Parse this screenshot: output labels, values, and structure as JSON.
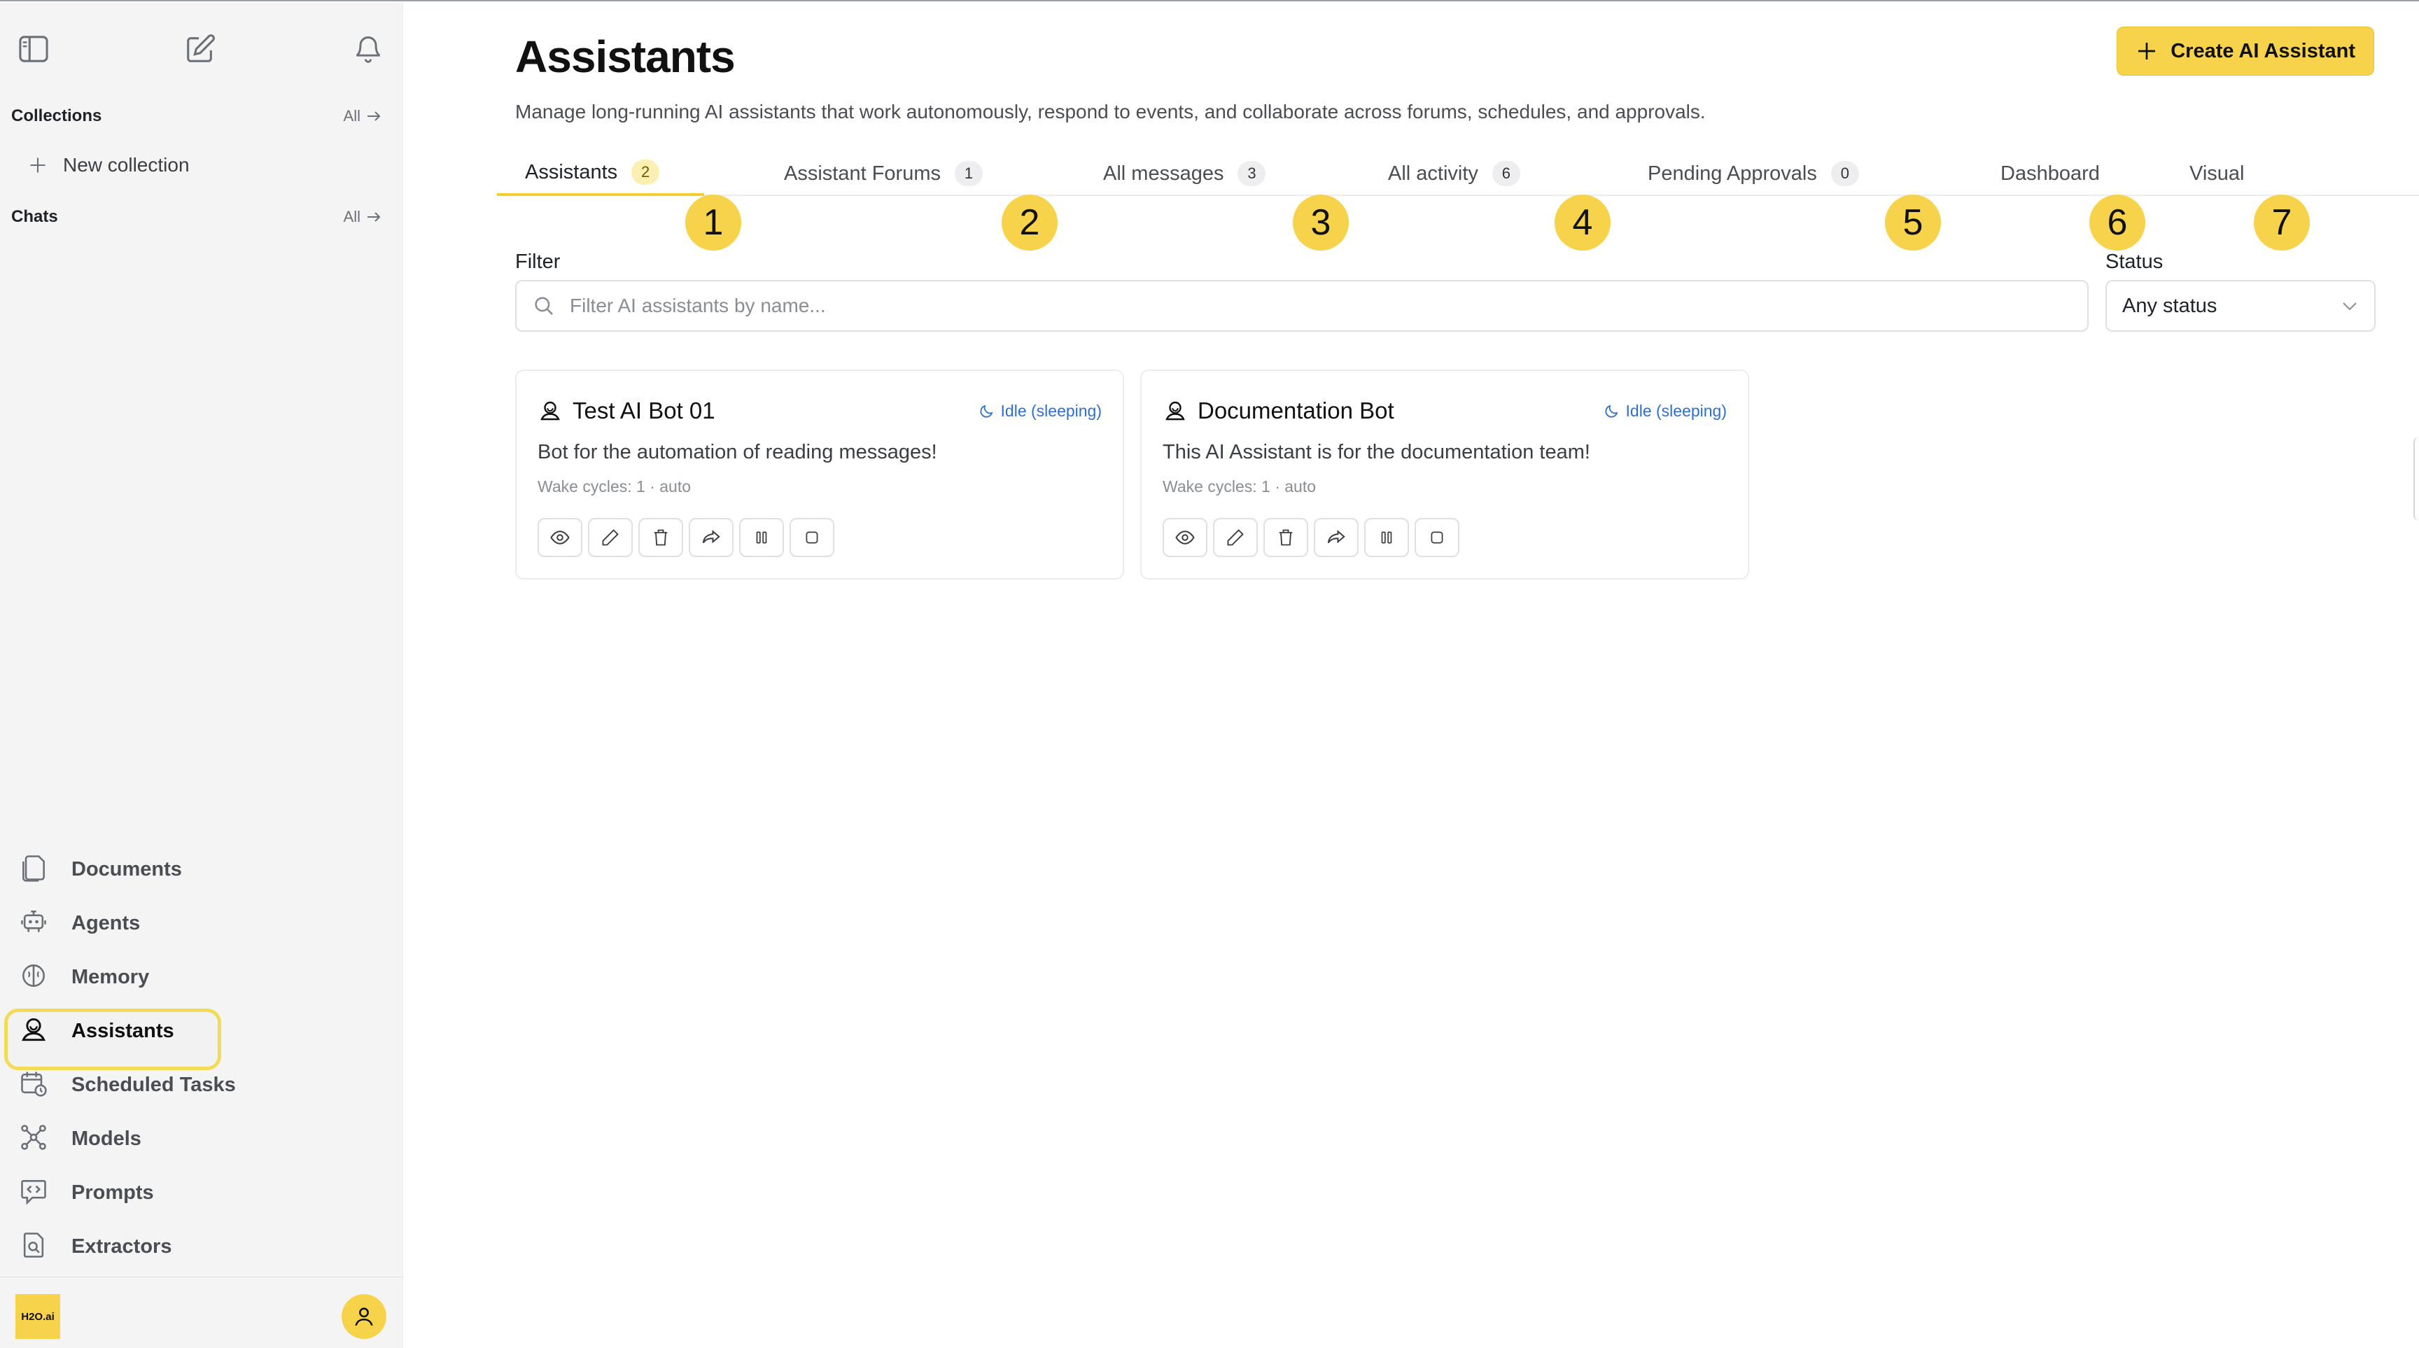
{
  "sidebar": {
    "collections_title": "Collections",
    "collections_all": "All",
    "new_collection": "New collection",
    "chats_title": "Chats",
    "chats_all": "All",
    "nav": [
      {
        "label": "Documents",
        "icon": "documents-icon"
      },
      {
        "label": "Agents",
        "icon": "robot-icon"
      },
      {
        "label": "Memory",
        "icon": "brain-icon"
      },
      {
        "label": "Assistants",
        "icon": "assistant-icon",
        "active": true
      },
      {
        "label": "Scheduled Tasks",
        "icon": "calendar-clock-icon"
      },
      {
        "label": "Models",
        "icon": "network-icon"
      },
      {
        "label": "Prompts",
        "icon": "code-bubble-icon"
      },
      {
        "label": "Extractors",
        "icon": "search-document-icon"
      }
    ],
    "logo_text": "H2O.ai"
  },
  "header": {
    "title": "Assistants",
    "description": "Manage long-running AI assistants that work autonomously, respond to events, and collaborate across forums, schedules, and approvals.",
    "create_button": "Create AI Assistant"
  },
  "tabs": [
    {
      "label": "Assistants",
      "count": "2",
      "active": true
    },
    {
      "label": "Assistant Forums",
      "count": "1"
    },
    {
      "label": "All messages",
      "count": "3"
    },
    {
      "label": "All activity",
      "count": "6"
    },
    {
      "label": "Pending Approvals",
      "count": "0"
    },
    {
      "label": "Dashboard"
    },
    {
      "label": "Visual"
    }
  ],
  "markers": [
    "1",
    "2",
    "3",
    "4",
    "5",
    "6",
    "7"
  ],
  "filter": {
    "label": "Filter",
    "placeholder": "Filter AI assistants by name..."
  },
  "status": {
    "label": "Status",
    "selected": "Any status"
  },
  "cards": [
    {
      "name": "Test AI Bot 01",
      "state": "Idle (sleeping)",
      "description": "Bot for the automation of reading messages!",
      "meta": "Wake cycles: 1  ·  auto"
    },
    {
      "name": "Documentation Bot",
      "state": "Idle (sleeping)",
      "description": "This AI Assistant is for the documentation team!",
      "meta": "Wake cycles: 1  ·  auto"
    }
  ],
  "colors": {
    "accent": "#f6d34b",
    "status_blue": "#2f6fd0",
    "sidebar_bg": "#f4f4f5"
  }
}
